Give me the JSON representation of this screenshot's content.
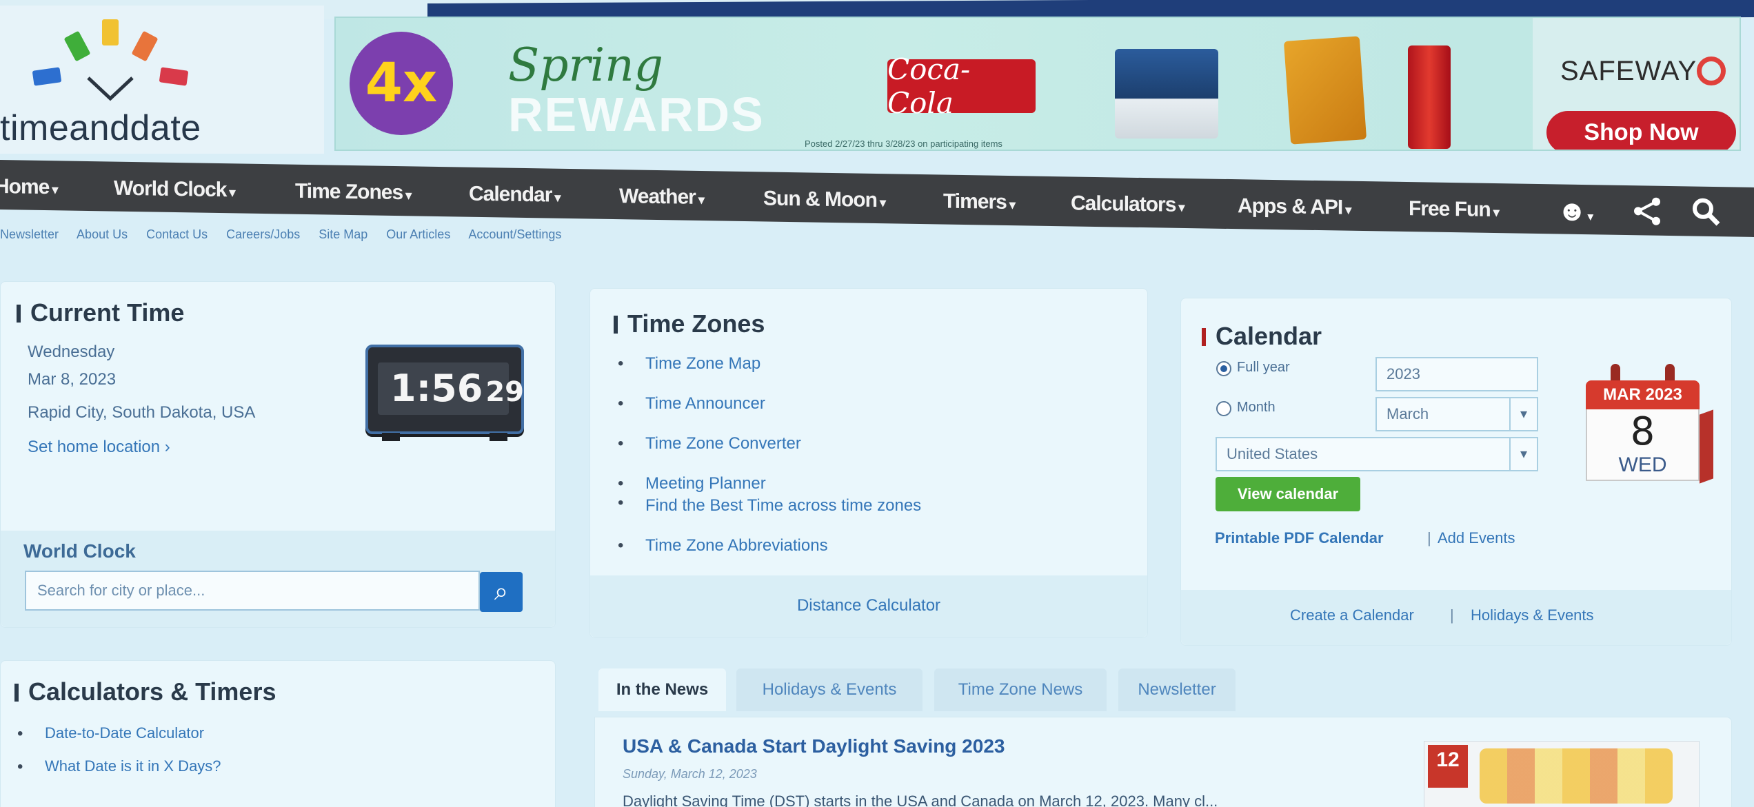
{
  "brand": {
    "name": "timeanddate",
    "logo_colors": [
      "#2d6fd0",
      "#3fae3a",
      "#f1c232",
      "#e8743b",
      "#d93a4a"
    ]
  },
  "ad": {
    "badge": "4x",
    "spring": "Spring",
    "rewards": "REWARDS",
    "fine_print": "Posted 2/27/23 thru 3/28/23 on participating items",
    "coke": "Coca-Cola",
    "retailer": "SAFEWAY",
    "cta": "Shop Now"
  },
  "nav": {
    "items": [
      {
        "label": "Home"
      },
      {
        "label": "World Clock"
      },
      {
        "label": "Time Zones"
      },
      {
        "label": "Calendar"
      },
      {
        "label": "Weather"
      },
      {
        "label": "Sun & Moon"
      },
      {
        "label": "Timers"
      },
      {
        "label": "Calculators"
      },
      {
        "label": "Apps & API"
      },
      {
        "label": "Free Fun"
      }
    ],
    "sub": [
      "Newsletter",
      "About Us",
      "Contact Us",
      "Careers/Jobs",
      "Site Map",
      "Our Articles",
      "Account/Settings"
    ]
  },
  "current_time": {
    "title": "Current Time",
    "weekday": "Wednesday",
    "date": "Mar 8, 2023",
    "location": "Rapid City, South Dakota, USA",
    "set_home": "Set home location",
    "clock_hm": "1:56",
    "clock_sec": "29",
    "world_clock_label": "World Clock",
    "search_placeholder": "Search for city or place..."
  },
  "time_zones": {
    "title": "Time Zones",
    "links": [
      "Time Zone Map",
      "Time Announcer",
      "Time Zone Converter",
      "Meeting Planner"
    ],
    "meeting_sub": "Find the Best Time across time zones",
    "abbrev": "Time Zone Abbreviations",
    "footer": "Distance Calculator"
  },
  "calendar": {
    "title": "Calendar",
    "full_year_label": "Full year",
    "month_label": "Month",
    "year_value": "2023",
    "month_value": "March",
    "country_value": "United States",
    "view_button": "View calendar",
    "printable": "Printable PDF Calendar",
    "sep": "|",
    "add_events": "Add Events",
    "create": "Create a Calendar",
    "holidays": "Holidays & Events",
    "icon_month": "MAR 2023",
    "icon_day": "8",
    "icon_dow": "WED"
  },
  "calculators": {
    "title": "Calculators & Timers",
    "links": [
      "Date-to-Date Calculator",
      "What Date is it in X Days?"
    ]
  },
  "news": {
    "tabs": [
      "In the News",
      "Holidays & Events",
      "Time Zone News",
      "Newsletter"
    ],
    "headline": "USA & Canada Start Daylight Saving 2023",
    "date": "Sunday, March 12, 2023",
    "body": "Daylight Saving Time (DST) starts in the USA and Canada on March 12, 2023. Many cl...",
    "thumb_badge": "12"
  }
}
